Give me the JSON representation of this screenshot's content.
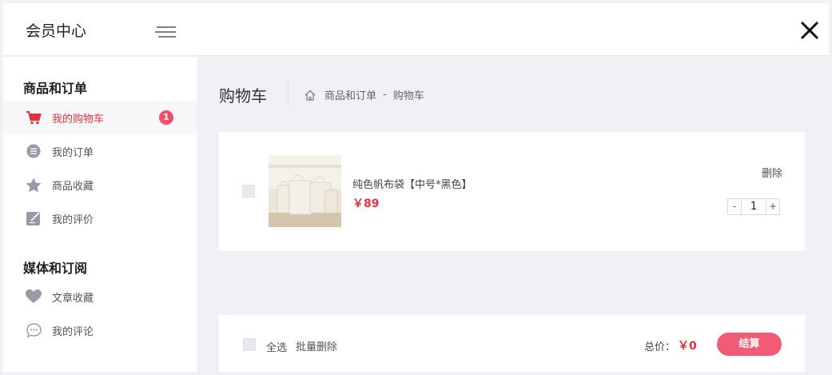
{
  "header": {
    "title": "会员中心",
    "menu_icon": "menu-icon",
    "close_icon": "close-icon"
  },
  "sidebar": {
    "sections": [
      {
        "title": "商品和订单",
        "items": [
          {
            "label": "我的购物车",
            "icon": "cart-icon",
            "active": true,
            "badge": "1"
          },
          {
            "label": "我的订单",
            "icon": "order-list-icon"
          },
          {
            "label": "商品收藏",
            "icon": "star-icon"
          },
          {
            "label": "我的评价",
            "icon": "edit-icon"
          }
        ]
      },
      {
        "title": "媒体和订阅",
        "items": [
          {
            "label": "文章收藏",
            "icon": "heart-icon"
          },
          {
            "label": "我的评论",
            "icon": "comment-icon"
          }
        ]
      }
    ]
  },
  "main": {
    "page_title": "购物车",
    "breadcrumb": {
      "home_icon": "home-icon",
      "items": [
        "商品和订单",
        "购物车"
      ],
      "separator": "-"
    },
    "cart": {
      "items": [
        {
          "name": "纯色帆布袋【中号*黑色】",
          "price": "￥89",
          "quantity": "1",
          "delete_label": "删除",
          "minus_label": "-",
          "plus_label": "+"
        }
      ]
    },
    "footer": {
      "select_all_label": "全选",
      "batch_delete_label": "批量删除",
      "total_label": "总价：",
      "total_value": "￥0",
      "checkout_label": "结算"
    }
  },
  "colors": {
    "accent": "#e0333f",
    "badge": "#f04e6a",
    "checkout": "#f25b76",
    "background": "#f0f1f5"
  }
}
